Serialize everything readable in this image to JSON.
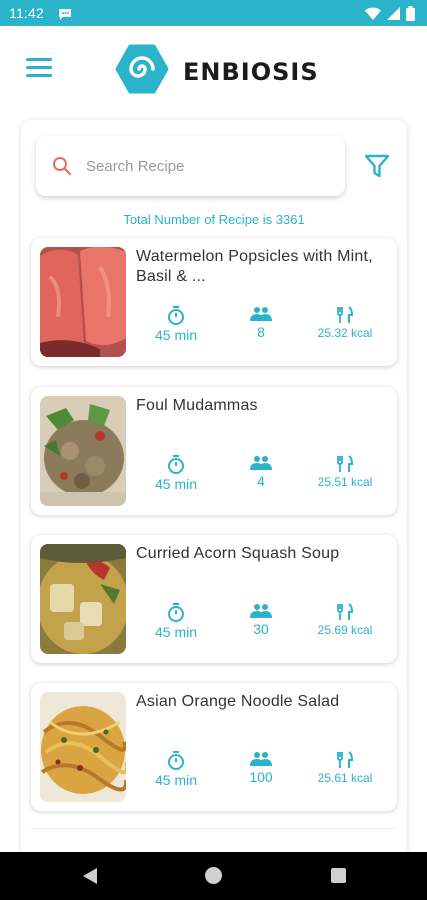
{
  "status_bar": {
    "time": "11:42"
  },
  "header": {
    "brand": "ENBIOSIS"
  },
  "search": {
    "placeholder": "Search Recipe",
    "value": ""
  },
  "summary": {
    "total_text": "Total Number of Recipe is 3361"
  },
  "recipes": [
    {
      "title": "Watermelon Popsicles with Mint, Basil & ...",
      "time": "45 min",
      "servings": "8",
      "calories": "25.32 kcal"
    },
    {
      "title": "Foul Mudammas",
      "time": "45 min",
      "servings": "4",
      "calories": "25.51 kcal"
    },
    {
      "title": "Curried Acorn Squash Soup",
      "time": "45 min",
      "servings": "30",
      "calories": "25.69 kcal"
    },
    {
      "title": "Asian Orange Noodle Salad",
      "time": "45 min",
      "servings": "100",
      "calories": "25.61 kcal"
    }
  ],
  "icons": {
    "menu": "menu-icon",
    "logo": "enbiosis-logo-icon",
    "search": "search-icon",
    "filter": "filter-icon",
    "time": "timer-icon",
    "servings": "people-icon",
    "calories": "cutlery-icon",
    "nav": [
      "back-icon",
      "home-icon",
      "recents-icon"
    ]
  },
  "colors": {
    "accent": "#2bb3c9",
    "search_icon": "#e8705a",
    "title_text": "#333333",
    "background": "#ffffff"
  }
}
